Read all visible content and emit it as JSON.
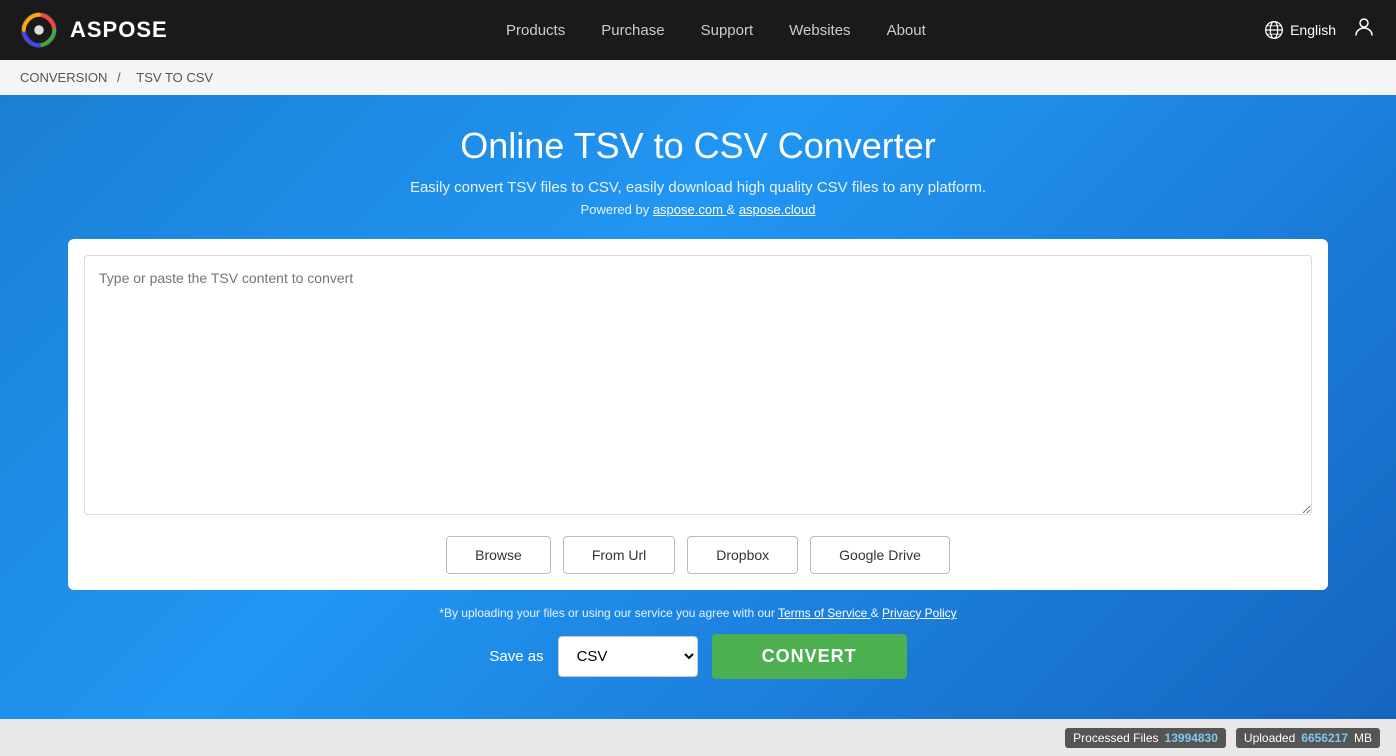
{
  "navbar": {
    "logo_text": "ASPOSE",
    "nav_items": [
      {
        "label": "Products"
      },
      {
        "label": "Purchase"
      },
      {
        "label": "Support"
      },
      {
        "label": "Websites"
      },
      {
        "label": "About"
      }
    ],
    "language": "English",
    "user_icon": "👤"
  },
  "breadcrumb": {
    "conversion": "CONVERSION",
    "separator": "/",
    "current": "TSV TO CSV"
  },
  "main": {
    "title": "Online TSV to CSV Converter",
    "subtitle": "Easily convert TSV files to CSV, easily download high quality CSV files to any platform.",
    "powered_by_text": "Powered by",
    "powered_by_link1": "aspose.com",
    "powered_by_amp": "&",
    "powered_by_link2": "aspose.cloud",
    "textarea_placeholder": "Type or paste the TSV content to convert",
    "buttons": {
      "browse": "Browse",
      "from_url": "From Url",
      "dropbox": "Dropbox",
      "google_drive": "Google Drive"
    },
    "terms_prefix": "*By uploading your files or using our service you agree with our",
    "terms_link1": "Terms of Service",
    "terms_amp": "&",
    "terms_link2": "Privacy Policy",
    "save_as_label": "Save as",
    "format_option": "CSV",
    "convert_button": "CONVERT"
  },
  "footer": {
    "processed_label": "Processed Files",
    "processed_count": "13994830",
    "uploaded_label": "Uploaded",
    "uploaded_count": "6656217",
    "uploaded_unit": "MB"
  }
}
